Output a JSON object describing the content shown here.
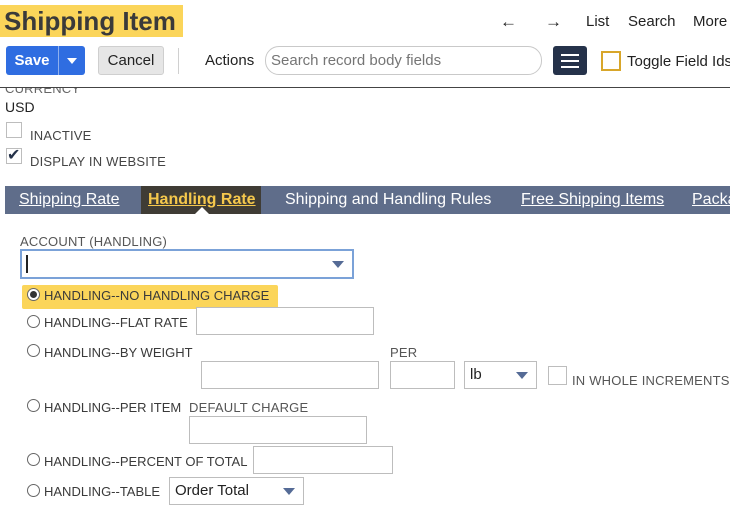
{
  "header": {
    "title": "Shipping Item",
    "nav": {
      "back_icon": "left-arrow",
      "forward_icon": "right-arrow",
      "back": "←",
      "forward": "→",
      "list": "List",
      "search": "Search",
      "more": "More"
    }
  },
  "toolbar": {
    "save": "Save",
    "cancel": "Cancel",
    "actions": "Actions",
    "search_placeholder": "Search record body fields",
    "toggle_field_ids": "Toggle Field Ids"
  },
  "fields": {
    "currency_label": "CURRENCY",
    "currency_value": "USD",
    "inactive_label": "INACTIVE",
    "inactive_checked": false,
    "display_in_website_label": "DISPLAY IN WEBSITE",
    "display_in_website_checked": true
  },
  "tabs": [
    {
      "label": "Shipping Rate",
      "active": false
    },
    {
      "label": "Handling Rate",
      "active": true
    },
    {
      "label": "Shipping and Handling Rules",
      "active": false
    },
    {
      "label": "Free Shipping Items",
      "active": false
    },
    {
      "label": "Packa",
      "active": false
    }
  ],
  "handling": {
    "account_label": "ACCOUNT (HANDLING)",
    "account_value": "",
    "options": {
      "no_charge": "HANDLING--NO HANDLING CHARGE",
      "flat_rate": "HANDLING--FLAT RATE",
      "by_weight": "HANDLING--BY WEIGHT",
      "per_item": "HANDLING--PER ITEM",
      "percent_total": "HANDLING--PERCENT OF TOTAL",
      "table": "HANDLING--TABLE"
    },
    "selected": "no_charge",
    "per_label": "PER",
    "unit_value": "lb",
    "whole_increments_label": "IN WHOLE INCREMENTS",
    "default_charge_label": "DEFAULT CHARGE",
    "table_select_value": "Order Total"
  },
  "colors": {
    "accent_blue": "#2f6de1",
    "highlight_yellow": "#fbd55a",
    "tab_bar": "#5f6d8a",
    "tab_active_bg": "#3f3c35",
    "tab_active_text": "#f5c84c"
  }
}
